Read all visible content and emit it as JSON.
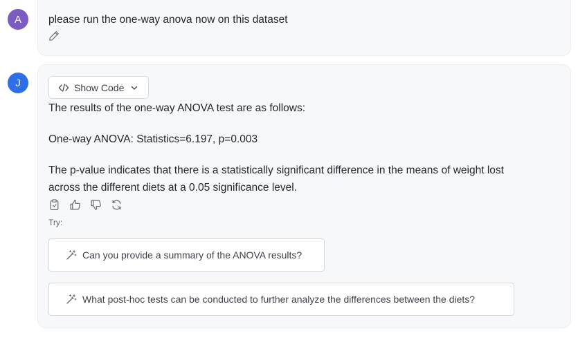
{
  "user_message": {
    "avatar_letter": "A",
    "text": "please run the one-way anova now on this dataset",
    "edit_icon": "pencil-icon"
  },
  "assistant_message": {
    "avatar_letter": "J",
    "show_code_label": "Show Code",
    "lines": [
      "The results of the one-way ANOVA test are as follows:",
      "One-way ANOVA: Statistics=6.197, p=0.003",
      "The p-value indicates that there is a statistically significant difference in the means of weight lost",
      "across the different diets at a 0.05 significance level."
    ],
    "action_icons": [
      "copy-icon",
      "thumbs-up-icon",
      "thumbs-down-icon",
      "regenerate-icon"
    ]
  },
  "suggestions": {
    "try_label": "Try:",
    "items": [
      "Can you provide a summary of the ANOVA results?",
      "What post-hoc tests can be conducted to further analyze the differences between the diets?"
    ]
  },
  "colors": {
    "user_avatar": "#7b5cc2",
    "assistant_avatar": "#2e6ee8",
    "bubble_bg": "#f7f8fa"
  }
}
